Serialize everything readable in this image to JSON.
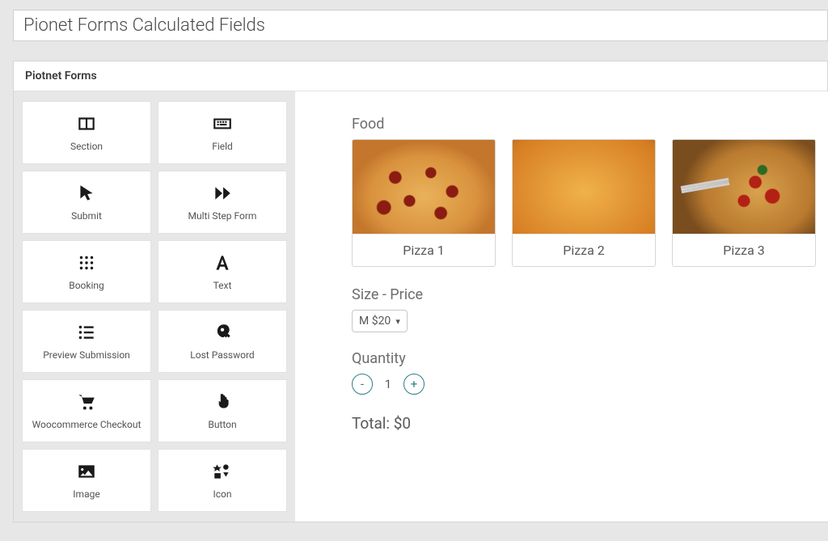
{
  "title": "Pionet Forms Calculated Fields",
  "panel_title": "Piotnet Forms",
  "widgets": [
    {
      "label": "Section",
      "icon": "columns-icon"
    },
    {
      "label": "Field",
      "icon": "keyboard-icon"
    },
    {
      "label": "Submit",
      "icon": "cursor-icon"
    },
    {
      "label": "Multi Step Form",
      "icon": "fast-forward-icon"
    },
    {
      "label": "Booking",
      "icon": "braille-icon"
    },
    {
      "label": "Text",
      "icon": "font-icon"
    },
    {
      "label": "Preview Submission",
      "icon": "list-icon"
    },
    {
      "label": "Lost Password",
      "icon": "key-icon"
    },
    {
      "label": "Woocommerce Checkout",
      "icon": "cart-icon"
    },
    {
      "label": "Button",
      "icon": "pointer-icon"
    },
    {
      "label": "Image",
      "icon": "image-icon"
    },
    {
      "label": "Icon",
      "icon": "icons-icon"
    }
  ],
  "form": {
    "food_label": "Food",
    "food_items": [
      "Pizza 1",
      "Pizza 2",
      "Pizza 3"
    ],
    "size_label": "Size - Price",
    "size_value": "M $20",
    "quantity_label": "Quantity",
    "quantity_value": "1",
    "minus": "-",
    "plus": "+",
    "total_text": "Total: $0"
  }
}
